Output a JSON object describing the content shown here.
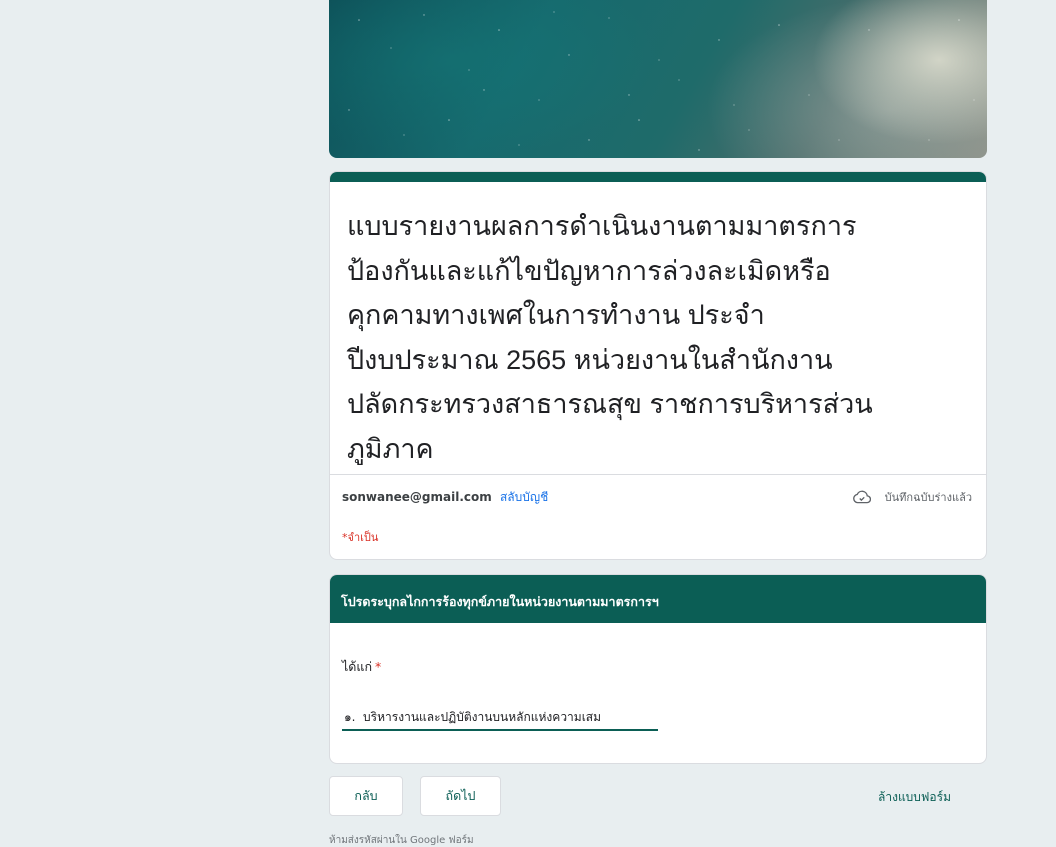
{
  "form": {
    "title": "แบบรายงานผลการดำเนินงานตามมาตรการ\nป้องกันและแก้ไขปัญหาการล่วงละเมิดหรือ\nคุกคามทางเพศในการทำงาน ประจำ\nปีงบประมาณ 2565 หน่วยงานในสำนักงาน\nปลัดกระทรวงสาธารณสุข  ราชการบริหารส่วน\nภูมิภาค",
    "account_email": "sonwanee@gmail.com",
    "switch_account_label": "สลับบัญชี",
    "draft_status": "บันทึกฉบับร่างแล้ว",
    "required_note": "*จำเป็น"
  },
  "section": {
    "header": "โปรดระบุกลไกการร้องทุกข์ภายในหน่วยงานตามมาตรการฯ",
    "question": "ได้แก่",
    "required_mark": "*",
    "answer_value": "๑.  บริหารงานและปฏิบัติงานบนหลักแห่งความเสม"
  },
  "nav": {
    "back_label": "กลับ",
    "next_label": "ถัดไป",
    "clear_label": "ล้างแบบฟอร์ม"
  },
  "footer": {
    "note": "ห้ามส่งรหัสผ่านใน Google ฟอร์ม"
  },
  "colors": {
    "theme": "#0b5e55",
    "background": "#e8eef0",
    "required": "#d93025",
    "link": "#1a73e8"
  },
  "icons": {
    "draft": "cloud-check-icon"
  }
}
